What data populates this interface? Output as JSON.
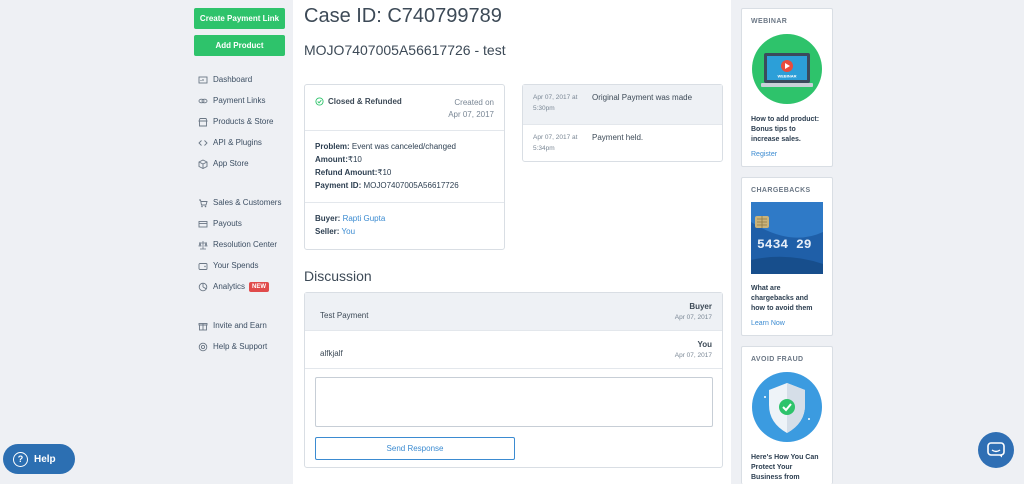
{
  "nav": {
    "create_payment_link": "Create Payment Link",
    "add_product": "Add Product",
    "group1": [
      {
        "label": "Dashboard",
        "icon": "dashboard-icon"
      },
      {
        "label": "Payment Links",
        "icon": "link-icon"
      },
      {
        "label": "Products & Store",
        "icon": "store-icon"
      },
      {
        "label": "API & Plugins",
        "icon": "code-icon"
      },
      {
        "label": "App Store",
        "icon": "box-icon"
      }
    ],
    "group2": [
      {
        "label": "Sales & Customers",
        "icon": "cart-icon"
      },
      {
        "label": "Payouts",
        "icon": "payouts-icon"
      },
      {
        "label": "Resolution Center",
        "icon": "scale-icon"
      },
      {
        "label": "Your Spends",
        "icon": "wallet-icon"
      },
      {
        "label": "Analytics",
        "icon": "chart-icon",
        "badge": "NEW"
      }
    ],
    "group3": [
      {
        "label": "Invite and Earn",
        "icon": "gift-icon"
      },
      {
        "label": "Help & Support",
        "icon": "support-icon"
      }
    ]
  },
  "case": {
    "title": "Case ID: C740799789",
    "subtitle": "MOJO7407005A56617726 - test",
    "status": "Closed & Refunded",
    "created_line1": "Created on",
    "created_line2": "Apr 07, 2017",
    "problem_label": "Problem:",
    "problem_value": "Event was canceled/changed",
    "amount_label": "Amount:",
    "amount_value": "₹10",
    "refund_label": "Refund Amount:",
    "refund_value": "₹10",
    "payment_id_label": "Payment ID:",
    "payment_id_value": "MOJO7407005A56617726",
    "buyer_label": "Buyer:",
    "buyer_value": "Rapti Gupta",
    "seller_label": "Seller:",
    "seller_value": "You"
  },
  "timeline": [
    {
      "date": "Apr 07, 2017 at",
      "time": "5:30pm",
      "text": "Original Payment was made"
    },
    {
      "date": "Apr 07, 2017 at",
      "time": "5:34pm",
      "text": "Payment held."
    }
  ],
  "discussion": {
    "title": "Discussion",
    "messages": [
      {
        "text": "Test Payment",
        "who": "Buyer",
        "date": "Apr 07, 2017"
      },
      {
        "text": "alfkjalf",
        "who": "You",
        "date": "Apr 07, 2017"
      }
    ],
    "reply_placeholder": "",
    "send_label": "Send Response"
  },
  "promos": [
    {
      "head": "WEBINAR",
      "img_label": "WEBINAR",
      "text": "How to add product: Bonus tips to increase sales.",
      "link": "Register"
    },
    {
      "head": "CHARGEBACKS",
      "card_number": "5434 29",
      "text": "What are chargebacks and how to avoid them",
      "link": "Learn Now"
    },
    {
      "head": "AVOID FRAUD",
      "text": "Here's How You Can Protect Your Business from",
      "link": ""
    }
  ],
  "help_label": "Help",
  "help_q": "?",
  "colors": {
    "green": "#2ec36b",
    "link": "#3b8bd1",
    "help": "#2c6fb2"
  }
}
